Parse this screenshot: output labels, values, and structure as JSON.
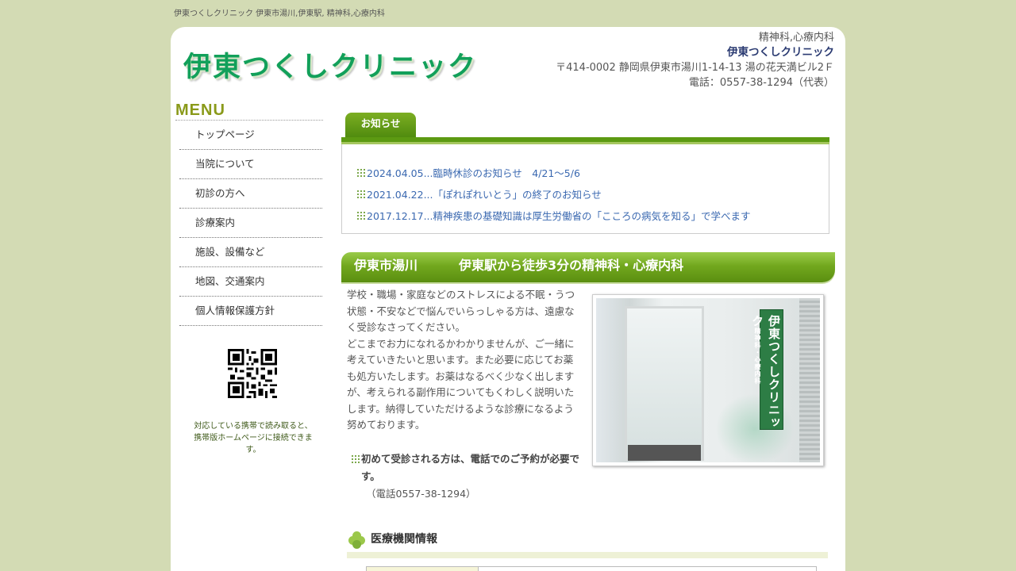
{
  "top_caption": "伊東つくしクリニック 伊東市湯川,伊東駅, 精神科,心療内科",
  "header": {
    "logo": "伊東つくしクリニック",
    "specialty": "精神科,心療内科",
    "clinic_name": "伊東つくしクリニック",
    "address": "〒414-0002 静岡県伊東市湯川1-14-13 湯の花天満ビル2Ｆ",
    "phone": "電話：0557-38-1294（代表）"
  },
  "sidebar": {
    "menu_title": "MENU",
    "items": [
      {
        "label": "トップページ"
      },
      {
        "label": "当院について"
      },
      {
        "label": "初診の方へ"
      },
      {
        "label": "診療案内"
      },
      {
        "label": "施設、設備など"
      },
      {
        "label": "地図、交通案内"
      },
      {
        "label": "個人情報保護方針"
      }
    ],
    "qr_caption": "対応している携帯で読み取ると、携帯版ホームページに接続できます。"
  },
  "news": {
    "tab_label": "お知らせ",
    "items": [
      {
        "text": "2024.04.05...臨時休診のお知らせ　4/21〜5/6"
      },
      {
        "text": "2021.04.22...「ぽれぽれいとう」の終了のお知らせ"
      },
      {
        "text": "2017.12.17...精神疾患の基礎知識は厚生労働省の「こころの病気を知る」で学べます"
      }
    ]
  },
  "section": {
    "place": "伊東市湯川",
    "title": "伊東駅から徒歩3分の精神科・心療内科"
  },
  "intro": {
    "p1": "学校・職場・家庭などのストレスによる不眠・うつ状態・不安などで悩んでいらっしゃる方は、遠慮なく受診なさってください。",
    "p2": "どこまでお力になれるかわかりませんが、ご一緒に考えていきたいと思います。また必要に応じてお薬も処方いたします。お薬はなるべく少なく出しますが、考えられる副作用についてもくわしく説明いたします。納得していただけるような診療になるよう努めております。"
  },
  "photo": {
    "sign_main": "伊東つくしクリニック",
    "sign_sub": "精神科・心療内科"
  },
  "callout": {
    "bold": "初めて受診される方は、電話でのご予約が必要です。",
    "phone": "（電話0557-38-1294）"
  },
  "medical_info": {
    "heading": "医療機関情報"
  },
  "colors": {
    "background": "#d3dbb4",
    "accent_green": "#5c9a12",
    "logo_green": "#12a05a",
    "link_blue": "#3a68b0"
  }
}
